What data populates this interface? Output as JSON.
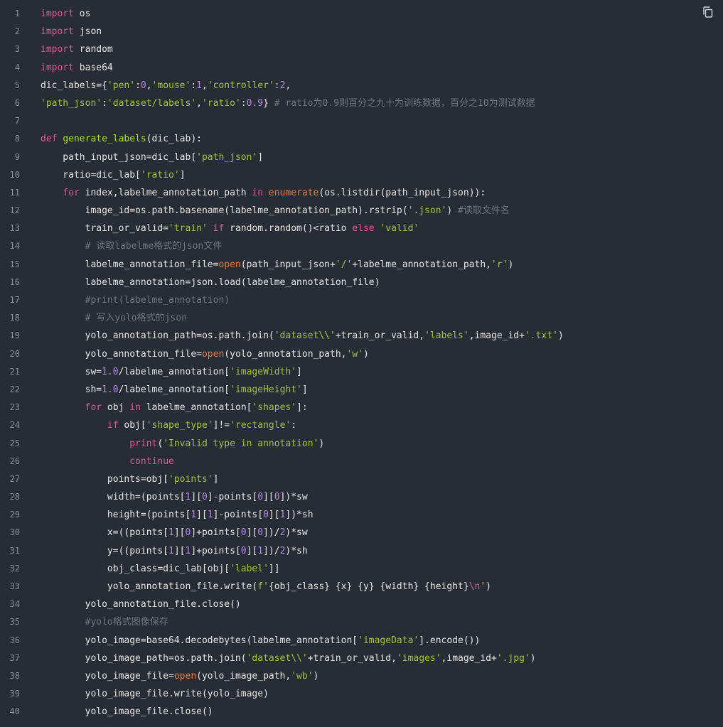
{
  "colors": {
    "background": "#282c34",
    "line_number": "#8a8f98",
    "plain": "#e8e8e8",
    "keyword": "#d75a94",
    "string": "#a7c13c",
    "number": "#b48ae6",
    "function_def": "#a6e22e",
    "builtin": "#e57b40",
    "comment": "#6f7680"
  },
  "toolbar": {
    "copy_icon": "copy-icon"
  },
  "lines": [
    {
      "n": "1",
      "tokens": [
        [
          "kw",
          "import"
        ],
        [
          "p",
          " os"
        ]
      ]
    },
    {
      "n": "2",
      "tokens": [
        [
          "kw",
          "import"
        ],
        [
          "p",
          " json"
        ]
      ]
    },
    {
      "n": "3",
      "tokens": [
        [
          "kw",
          "import"
        ],
        [
          "p",
          " random"
        ]
      ]
    },
    {
      "n": "4",
      "tokens": [
        [
          "kw",
          "import"
        ],
        [
          "p",
          " base64"
        ]
      ]
    },
    {
      "n": "5",
      "tokens": [
        [
          "p",
          "dic_labels={"
        ],
        [
          "s",
          "'pen'"
        ],
        [
          "p",
          ":"
        ],
        [
          "num",
          "0"
        ],
        [
          "p",
          ","
        ],
        [
          "s",
          "'mouse'"
        ],
        [
          "p",
          ":"
        ],
        [
          "num",
          "1"
        ],
        [
          "p",
          ","
        ],
        [
          "s",
          "'controller'"
        ],
        [
          "p",
          ":"
        ],
        [
          "num",
          "2"
        ],
        [
          "p",
          ","
        ]
      ]
    },
    {
      "n": "6",
      "tokens": [
        [
          "s",
          "'path_json'"
        ],
        [
          "p",
          ":"
        ],
        [
          "s",
          "'dataset/labels'"
        ],
        [
          "p",
          ","
        ],
        [
          "s",
          "'ratio'"
        ],
        [
          "p",
          ":"
        ],
        [
          "num",
          "0.9"
        ],
        [
          "p",
          "} "
        ],
        [
          "c",
          "# ratio为0.9则百分之九十为训练数据，百分之10为测试数据"
        ]
      ]
    },
    {
      "n": "7",
      "tokens": []
    },
    {
      "n": "8",
      "tokens": [
        [
          "kw",
          "def"
        ],
        [
          "p",
          " "
        ],
        [
          "fn",
          "generate_labels"
        ],
        [
          "p",
          "(dic_lab):"
        ]
      ]
    },
    {
      "n": "9",
      "tokens": [
        [
          "p",
          "    path_input_json=dic_lab["
        ],
        [
          "s",
          "'path_json'"
        ],
        [
          "p",
          "]"
        ]
      ]
    },
    {
      "n": "10",
      "tokens": [
        [
          "p",
          "    ratio=dic_lab["
        ],
        [
          "s",
          "'ratio'"
        ],
        [
          "p",
          "]"
        ]
      ]
    },
    {
      "n": "11",
      "tokens": [
        [
          "p",
          "    "
        ],
        [
          "kw",
          "for"
        ],
        [
          "p",
          " index,labelme_annotation_path "
        ],
        [
          "kw",
          "in"
        ],
        [
          "p",
          " "
        ],
        [
          "bi",
          "enumerate"
        ],
        [
          "p",
          "(os.listdir(path_input_json)):"
        ]
      ]
    },
    {
      "n": "12",
      "tokens": [
        [
          "p",
          "        image_id=os.path.basename(labelme_annotation_path).rstrip("
        ],
        [
          "s",
          "'.json'"
        ],
        [
          "p",
          ") "
        ],
        [
          "c",
          "#读取文件名"
        ]
      ]
    },
    {
      "n": "13",
      "tokens": [
        [
          "p",
          "        train_or_valid="
        ],
        [
          "s",
          "'train'"
        ],
        [
          "p",
          " "
        ],
        [
          "kw",
          "if"
        ],
        [
          "p",
          " random.random()<ratio "
        ],
        [
          "kw",
          "else"
        ],
        [
          "p",
          " "
        ],
        [
          "s",
          "'valid'"
        ]
      ]
    },
    {
      "n": "14",
      "tokens": [
        [
          "p",
          "        "
        ],
        [
          "c",
          "# 读取labelme格式的json文件"
        ]
      ]
    },
    {
      "n": "15",
      "tokens": [
        [
          "p",
          "        labelme_annotation_file="
        ],
        [
          "bi",
          "open"
        ],
        [
          "p",
          "(path_input_json+"
        ],
        [
          "s",
          "'/'"
        ],
        [
          "p",
          "+labelme_annotation_path,"
        ],
        [
          "s",
          "'r'"
        ],
        [
          "p",
          ")"
        ]
      ]
    },
    {
      "n": "16",
      "tokens": [
        [
          "p",
          "        labelme_annotation=json.load(labelme_annotation_file)"
        ]
      ]
    },
    {
      "n": "17",
      "tokens": [
        [
          "p",
          "        "
        ],
        [
          "c",
          "#print(labelme_annotation)"
        ]
      ]
    },
    {
      "n": "18",
      "tokens": [
        [
          "p",
          "        "
        ],
        [
          "c",
          "# 写入yolo格式的json"
        ]
      ]
    },
    {
      "n": "19",
      "tokens": [
        [
          "p",
          "        yolo_annotation_path=os.path.join("
        ],
        [
          "s",
          "'dataset\\\\'"
        ],
        [
          "p",
          "+train_or_valid,"
        ],
        [
          "s",
          "'labels'"
        ],
        [
          "p",
          ",image_id+"
        ],
        [
          "s",
          "'.txt'"
        ],
        [
          "p",
          ")"
        ]
      ]
    },
    {
      "n": "20",
      "tokens": [
        [
          "p",
          "        yolo_annotation_file="
        ],
        [
          "bi",
          "open"
        ],
        [
          "p",
          "(yolo_annotation_path,"
        ],
        [
          "s",
          "'w'"
        ],
        [
          "p",
          ")"
        ]
      ]
    },
    {
      "n": "21",
      "tokens": [
        [
          "p",
          "        sw="
        ],
        [
          "num",
          "1.0"
        ],
        [
          "p",
          "/labelme_annotation["
        ],
        [
          "s",
          "'imageWidth'"
        ],
        [
          "p",
          "]"
        ]
      ]
    },
    {
      "n": "22",
      "tokens": [
        [
          "p",
          "        sh="
        ],
        [
          "num",
          "1.0"
        ],
        [
          "p",
          "/labelme_annotation["
        ],
        [
          "s",
          "'imageHeight'"
        ],
        [
          "p",
          "]"
        ]
      ]
    },
    {
      "n": "23",
      "tokens": [
        [
          "p",
          "        "
        ],
        [
          "kw",
          "for"
        ],
        [
          "p",
          " obj "
        ],
        [
          "kw",
          "in"
        ],
        [
          "p",
          " labelme_annotation["
        ],
        [
          "s",
          "'shapes'"
        ],
        [
          "p",
          "]:"
        ]
      ]
    },
    {
      "n": "24",
      "tokens": [
        [
          "p",
          "            "
        ],
        [
          "kw",
          "if"
        ],
        [
          "p",
          " obj["
        ],
        [
          "s",
          "'shape_type'"
        ],
        [
          "p",
          "]!="
        ],
        [
          "s",
          "'rectangle'"
        ],
        [
          "p",
          ":"
        ]
      ]
    },
    {
      "n": "25",
      "tokens": [
        [
          "p",
          "                "
        ],
        [
          "kw",
          "print"
        ],
        [
          "p",
          "("
        ],
        [
          "s",
          "'Invalid type in annotation'"
        ],
        [
          "p",
          ")"
        ]
      ]
    },
    {
      "n": "26",
      "tokens": [
        [
          "p",
          "                "
        ],
        [
          "kw",
          "continue"
        ]
      ]
    },
    {
      "n": "27",
      "tokens": [
        [
          "p",
          "            points=obj["
        ],
        [
          "s",
          "'points'"
        ],
        [
          "p",
          "]"
        ]
      ]
    },
    {
      "n": "28",
      "tokens": [
        [
          "p",
          "            width=(points["
        ],
        [
          "num",
          "1"
        ],
        [
          "p",
          "]["
        ],
        [
          "num",
          "0"
        ],
        [
          "p",
          "]-points["
        ],
        [
          "num",
          "0"
        ],
        [
          "p",
          "]["
        ],
        [
          "num",
          "0"
        ],
        [
          "p",
          "])*sw"
        ]
      ]
    },
    {
      "n": "29",
      "tokens": [
        [
          "p",
          "            height=(points["
        ],
        [
          "num",
          "1"
        ],
        [
          "p",
          "]["
        ],
        [
          "num",
          "1"
        ],
        [
          "p",
          "]-points["
        ],
        [
          "num",
          "0"
        ],
        [
          "p",
          "]["
        ],
        [
          "num",
          "1"
        ],
        [
          "p",
          "])*sh"
        ]
      ]
    },
    {
      "n": "30",
      "tokens": [
        [
          "p",
          "            x=((points["
        ],
        [
          "num",
          "1"
        ],
        [
          "p",
          "]["
        ],
        [
          "num",
          "0"
        ],
        [
          "p",
          "]+points["
        ],
        [
          "num",
          "0"
        ],
        [
          "p",
          "]["
        ],
        [
          "num",
          "0"
        ],
        [
          "p",
          "])/"
        ],
        [
          "num",
          "2"
        ],
        [
          "p",
          ")*sw"
        ]
      ]
    },
    {
      "n": "31",
      "tokens": [
        [
          "p",
          "            y=((points["
        ],
        [
          "num",
          "1"
        ],
        [
          "p",
          "]["
        ],
        [
          "num",
          "1"
        ],
        [
          "p",
          "]+points["
        ],
        [
          "num",
          "0"
        ],
        [
          "p",
          "]["
        ],
        [
          "num",
          "1"
        ],
        [
          "p",
          "])/"
        ],
        [
          "num",
          "2"
        ],
        [
          "p",
          ")*sh"
        ]
      ]
    },
    {
      "n": "32",
      "tokens": [
        [
          "p",
          "            obj_class=dic_lab[obj["
        ],
        [
          "s",
          "'label'"
        ],
        [
          "p",
          "]]"
        ]
      ]
    },
    {
      "n": "33",
      "tokens": [
        [
          "p",
          "            yolo_annotation_file.write("
        ],
        [
          "s",
          "f'"
        ],
        [
          "p",
          "{obj_class} {x} {y} {width} {height}"
        ],
        [
          "kw",
          "\\n"
        ],
        [
          "s",
          "'"
        ],
        [
          "p",
          ")"
        ]
      ]
    },
    {
      "n": "34",
      "tokens": [
        [
          "p",
          "        yolo_annotation_file.close()"
        ]
      ]
    },
    {
      "n": "35",
      "tokens": [
        [
          "p",
          "        "
        ],
        [
          "c",
          "#yolo格式图像保存"
        ]
      ]
    },
    {
      "n": "36",
      "tokens": [
        [
          "p",
          "        yolo_image=base64.decodebytes(labelme_annotation["
        ],
        [
          "s",
          "'imageData'"
        ],
        [
          "p",
          "].encode())"
        ]
      ]
    },
    {
      "n": "37",
      "tokens": [
        [
          "p",
          "        yolo_image_path=os.path.join("
        ],
        [
          "s",
          "'dataset\\\\'"
        ],
        [
          "p",
          "+train_or_valid,"
        ],
        [
          "s",
          "'images'"
        ],
        [
          "p",
          ",image_id+"
        ],
        [
          "s",
          "'.jpg'"
        ],
        [
          "p",
          ")"
        ]
      ]
    },
    {
      "n": "38",
      "tokens": [
        [
          "p",
          "        yolo_image_file="
        ],
        [
          "bi",
          "open"
        ],
        [
          "p",
          "(yolo_image_path,"
        ],
        [
          "s",
          "'wb'"
        ],
        [
          "p",
          ")"
        ]
      ]
    },
    {
      "n": "39",
      "tokens": [
        [
          "p",
          "        yolo_image_file.write(yolo_image)"
        ]
      ]
    },
    {
      "n": "40",
      "tokens": [
        [
          "p",
          "        yolo_image_file.close()"
        ]
      ]
    }
  ]
}
